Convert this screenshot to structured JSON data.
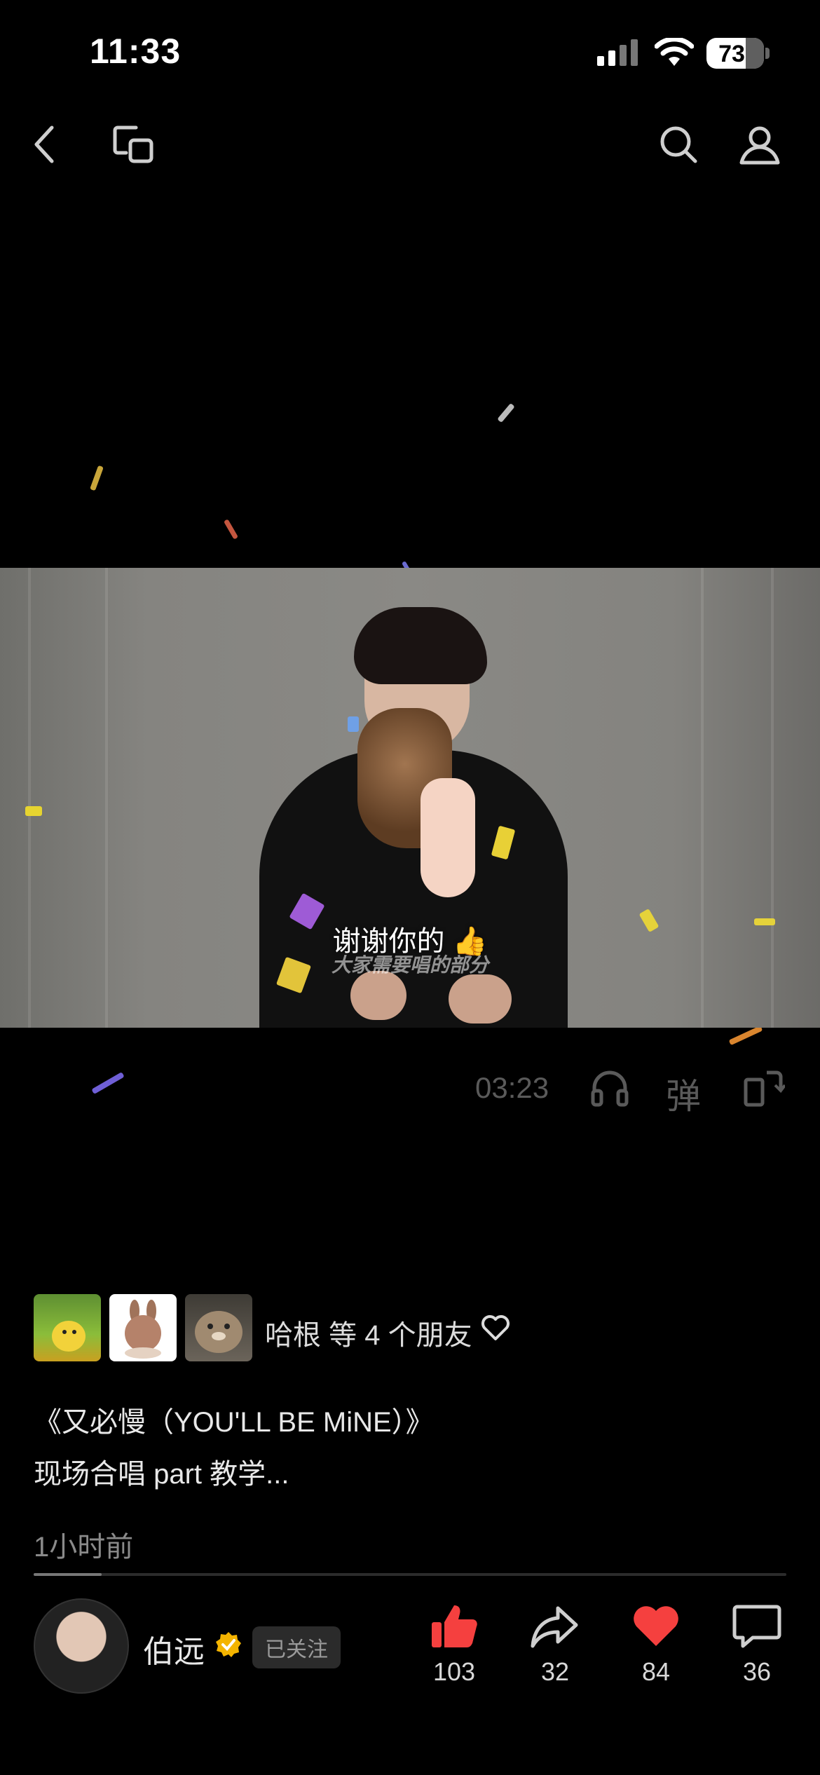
{
  "status_bar": {
    "time": "11:33",
    "battery": "73"
  },
  "nav": {
    "back_icon": "chevron-left-icon",
    "pip_icon": "picture-in-picture-icon",
    "search_icon": "search-icon",
    "profile_icon": "user-icon"
  },
  "video": {
    "caption": "谢谢你的 👍",
    "caption_sub": "大家需要唱的部分"
  },
  "player": {
    "duration": "03:23",
    "headphone_icon": "headphone-icon",
    "danmu_label": "弹",
    "rotate_icon": "rotate-screen-icon"
  },
  "friends": {
    "text": "哈根 等 4 个朋友",
    "heart_icon": "heart-outline-icon"
  },
  "post": {
    "title": "《又必慢（YOU'LL BE MiNE）》",
    "subtitle": "现场合唱 part 教学...",
    "time_ago": "1小时前",
    "progress": 0.09
  },
  "author": {
    "name": "伯远",
    "follow_label": "已关注"
  },
  "actions": {
    "like_count": "103",
    "share_count": "32",
    "favorite_count": "84",
    "comment_count": "36"
  },
  "colors": {
    "like": "#f5403f",
    "favorite": "#f5403f",
    "verified": "#f4b400"
  }
}
